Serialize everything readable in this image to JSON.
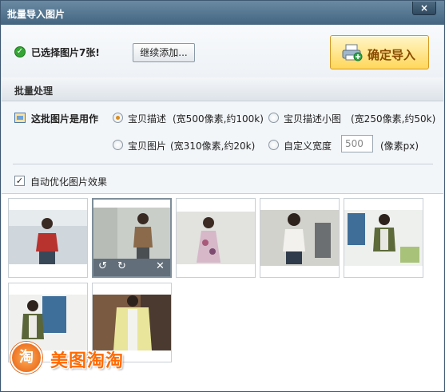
{
  "window": {
    "title": "批量导入图片",
    "close_glyph": "×"
  },
  "top": {
    "status_text": "已选择图片7张!",
    "add_more_label": "继续添加...",
    "confirm_label": "确定导入"
  },
  "section": {
    "title": "批量处理"
  },
  "usage": {
    "label": "这批图片是用作",
    "options": [
      {
        "label": "宝贝描述",
        "hint": "(宽500像素,约100k)",
        "selected": true
      },
      {
        "label": "宝贝描述小图",
        "hint": "(宽250像素,约50k)",
        "selected": false
      },
      {
        "label": "宝贝图片",
        "hint": "(宽310像素,约20k)",
        "selected": false
      },
      {
        "label": "自定义宽度",
        "hint": "",
        "selected": false
      }
    ],
    "custom_width_value": "500",
    "custom_width_unit": "(像素px)",
    "auto_optimize_label": "自动优化图片效果",
    "auto_optimize_checked": true
  },
  "thumbnails": [
    {
      "name": "photo-1",
      "selected": false
    },
    {
      "name": "photo-2",
      "selected": true
    },
    {
      "name": "photo-3",
      "selected": false
    },
    {
      "name": "photo-4",
      "selected": false
    },
    {
      "name": "photo-5",
      "selected": false
    },
    {
      "name": "photo-6",
      "selected": false
    },
    {
      "name": "photo-7",
      "selected": false
    }
  ],
  "watermark": {
    "badge": "淘",
    "text": "美图淘淘"
  },
  "colors": {
    "accent": "#ffd75a",
    "titlebar": "#44657f",
    "radio_selected": "#d98c1f"
  }
}
